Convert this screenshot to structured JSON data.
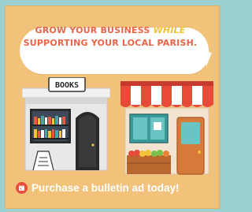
{
  "headline": {
    "line1_prefix": "GROW YOUR BUSINESS",
    "line1_accent": "WHILE",
    "line2": "SUPPORTING YOUR LOCAL PARISH."
  },
  "bookstore": {
    "sign": "BOOKS"
  },
  "cta": {
    "text": "Purchase a bulletin ad today!"
  },
  "colors": {
    "background": "#9ccfd0",
    "panel": "#f3c27a",
    "headline": "#e86548",
    "accent": "#f1c237",
    "awning_red": "#e84a3a",
    "cta_icon": "#e94e3d"
  }
}
